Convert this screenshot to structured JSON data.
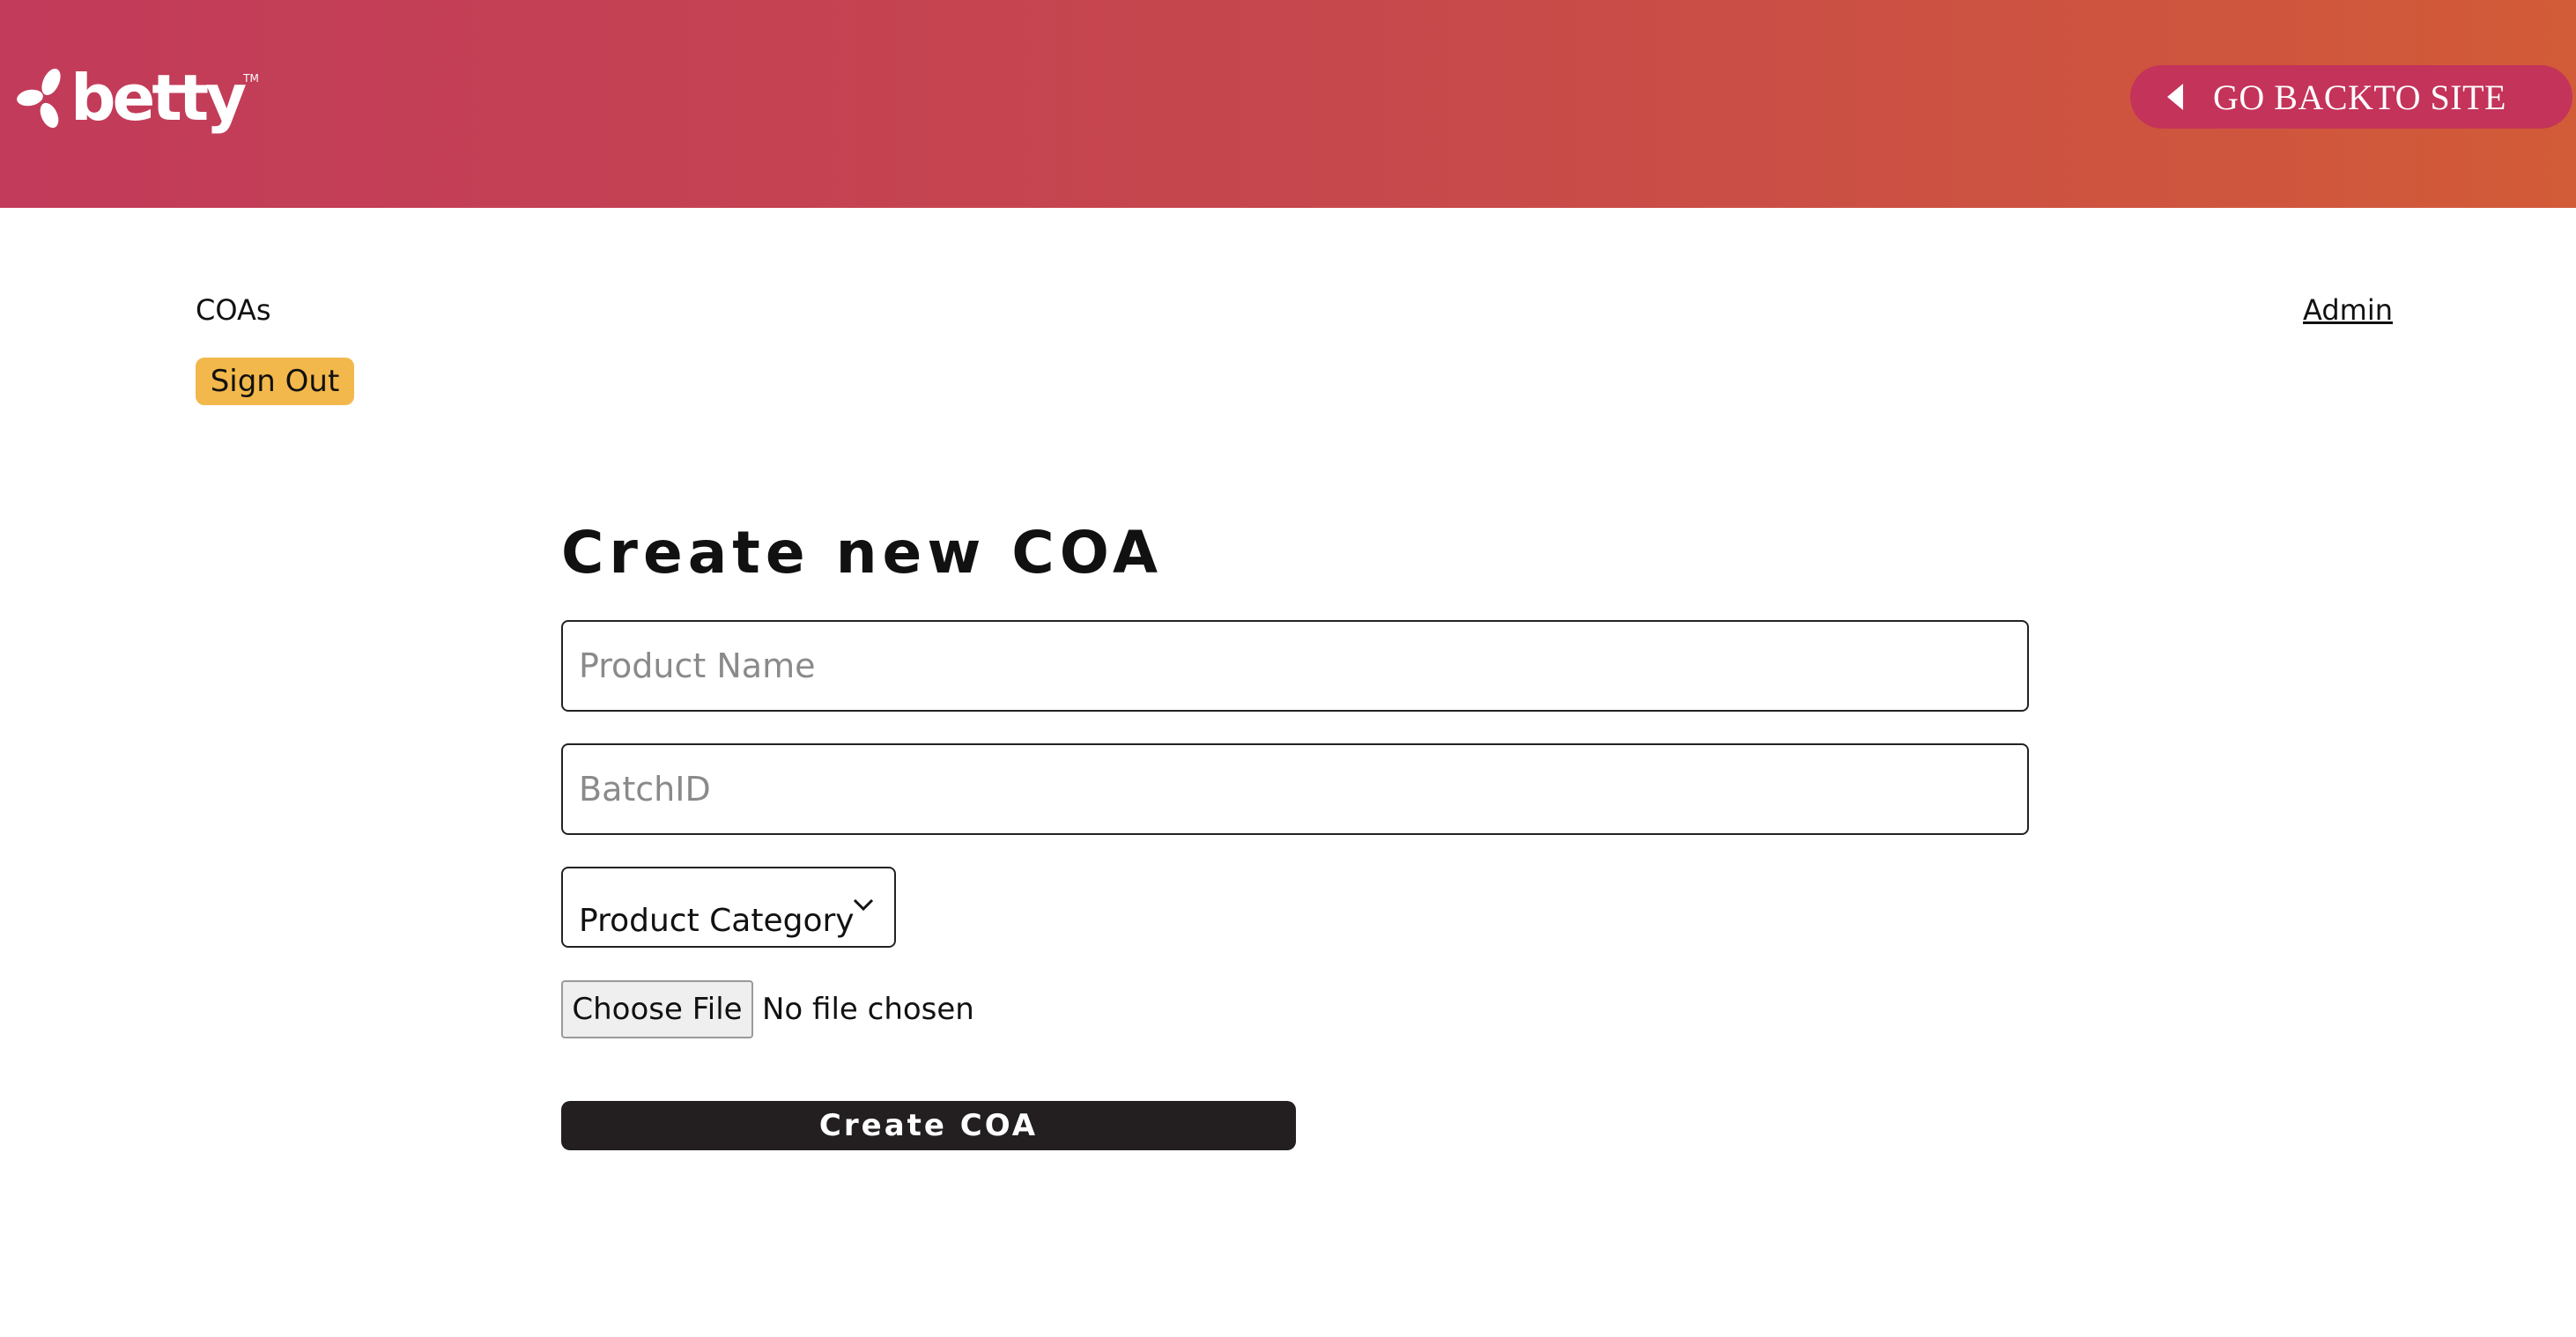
{
  "header": {
    "logo_text": "betty",
    "logo_tm": "TM",
    "back_label": "GO BACKTO SITE",
    "gradient_start": "#c23b5a",
    "gradient_end": "#d25b38",
    "back_button_color": "#c4335a"
  },
  "nav": {
    "coas_label": "COAs",
    "admin_label": "Admin",
    "signout_label": "Sign Out",
    "signout_color": "#f2b84b"
  },
  "form": {
    "title": "Create new COA",
    "product_name_placeholder": "Product Name",
    "batch_id_placeholder": "BatchID",
    "category_selected": "Product Category",
    "file_button_label": "Choose File",
    "file_status": "No file chosen",
    "submit_label": "Create COA",
    "submit_color": "#231f20"
  },
  "icons": {
    "logo": "leaf-cluster-icon",
    "back": "caret-left-icon",
    "select": "chevron-down-icon"
  }
}
